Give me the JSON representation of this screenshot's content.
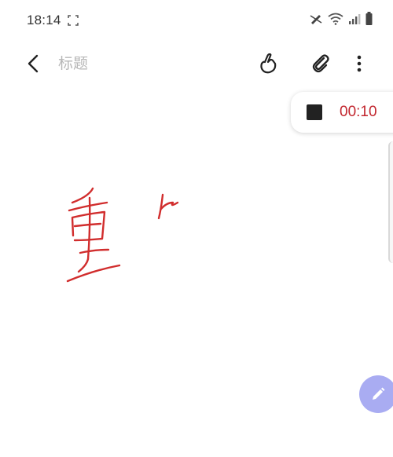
{
  "status_bar": {
    "time": "18:14",
    "icons": [
      "screen-record-icon",
      "wifi-icon",
      "signal-icon",
      "battery-icon"
    ]
  },
  "app_bar": {
    "title_placeholder": "标题",
    "title_value": "",
    "actions": [
      "back-icon",
      "handwriting-icon",
      "attachment-icon",
      "more-vert-icon"
    ]
  },
  "voice_recording": {
    "elapsed": "00:10",
    "time_color": "#c2262e"
  },
  "handwriting": {
    "ink_color": "#d12d2d"
  },
  "fab": {
    "icon": "pen-icon",
    "color": "#a9acf2"
  }
}
